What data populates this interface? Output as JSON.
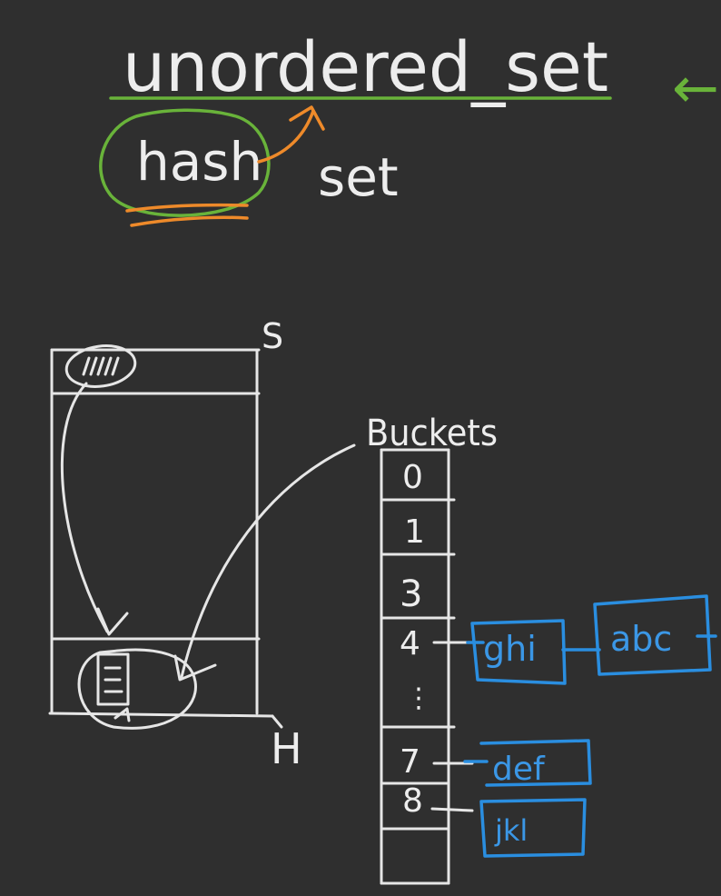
{
  "board": {
    "title": "unordered_set",
    "hash_word": "hash",
    "set_word": "set",
    "arrow_glyph": "←",
    "s_label": "S",
    "h_label": "H",
    "buckets_label": "Buckets",
    "bucket_indices": [
      "0",
      "1",
      "3",
      "4",
      "⋮",
      "7",
      "8"
    ],
    "chain_4": [
      "ghi",
      "abc"
    ],
    "chain_7": [
      "def"
    ],
    "chain_8": [
      "jkl"
    ],
    "colors": {
      "background": "#2f2f2f",
      "chalk": "#e6e6e6",
      "green": "#69b33a",
      "orange": "#ee8a2a",
      "blue": "#2a8ee0"
    }
  }
}
